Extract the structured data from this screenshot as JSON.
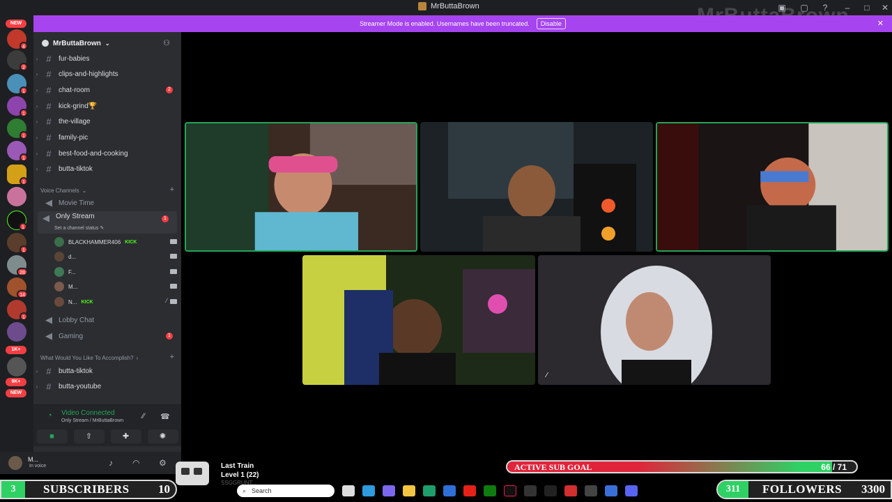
{
  "window": {
    "title": "MrButtaBrown",
    "watermark": "MrButtaBrown"
  },
  "banner": {
    "message": "Streamer Mode is enabled. Usernames have been truncated.",
    "disable_label": "Disable"
  },
  "server_rail": {
    "tags": [
      "NEW",
      "1K+",
      "9K+",
      "NEW"
    ],
    "badges": [
      "4",
      "2",
      "1",
      "1",
      "1",
      "1",
      "1",
      "1",
      "1",
      "1",
      "1",
      "1",
      "1",
      "28",
      "14",
      "1",
      "1",
      "1"
    ]
  },
  "server": {
    "name": "MrButtaBrown"
  },
  "channels": [
    {
      "name": "fur-babies",
      "badge": ""
    },
    {
      "name": "clips-and-highlights",
      "badge": ""
    },
    {
      "name": "chat-room",
      "badge": "2"
    },
    {
      "name": "kick-grind🏆",
      "badge": ""
    },
    {
      "name": "the-village",
      "badge": ""
    },
    {
      "name": "family-pic",
      "badge": ""
    },
    {
      "name": "best-food-and-cooking",
      "badge": ""
    },
    {
      "name": "butta-tiktok",
      "badge": ""
    }
  ],
  "voice_category": {
    "label": "Voice Channels"
  },
  "voice_channels": {
    "movie_time": "Movie Time",
    "only_stream": {
      "name": "Only Stream",
      "status": "Set a channel status",
      "badge": "1"
    },
    "lobby_chat": "Lobby Chat",
    "gaming": {
      "name": "Gaming",
      "badge": "1"
    }
  },
  "members": [
    {
      "name": "BLACKHAMMER406",
      "tag": "KICK",
      "color": "#3b6e4a"
    },
    {
      "name": "d...",
      "tag": "",
      "color": "#5a4637"
    },
    {
      "name": "F...",
      "tag": "",
      "color": "#3e7a56"
    },
    {
      "name": "M...",
      "tag": "",
      "color": "#7a5a4c"
    },
    {
      "name": "N...",
      "tag": "KICK",
      "color": "#6a4a3c"
    }
  ],
  "category2": {
    "label": "What Would You Like To Accomplish?"
  },
  "channels2": [
    {
      "name": "butta-tiktok"
    },
    {
      "name": "butta-youtube"
    }
  ],
  "voice_panel": {
    "title": "Video Connected",
    "subtitle": "Only Stream / MrButtaBrown"
  },
  "user_panel": {
    "name": "M...",
    "status": "In voice"
  },
  "overlay": {
    "sub_goal": {
      "label": "ACTIVE SUB GOAL",
      "current": 66,
      "target": 71,
      "display": "66 / 71"
    },
    "subscribers": {
      "count": "3",
      "label": "SUBSCRIBERS",
      "goal": "10"
    },
    "followers": {
      "count": "311",
      "label": "FOLLOWERS",
      "goal": "3300"
    },
    "music": {
      "title": "Last Train",
      "level": "Level 1  (22)",
      "user": "SSGGRUNT..."
    }
  },
  "taskbar": {
    "search_placeholder": "Search"
  },
  "colors": {
    "discord_bg": "#2b2d31",
    "accent_purple": "#a644ef",
    "speaking_green": "#23a55a",
    "kick_green": "#53fc18",
    "goal_red": "#e0243a"
  }
}
